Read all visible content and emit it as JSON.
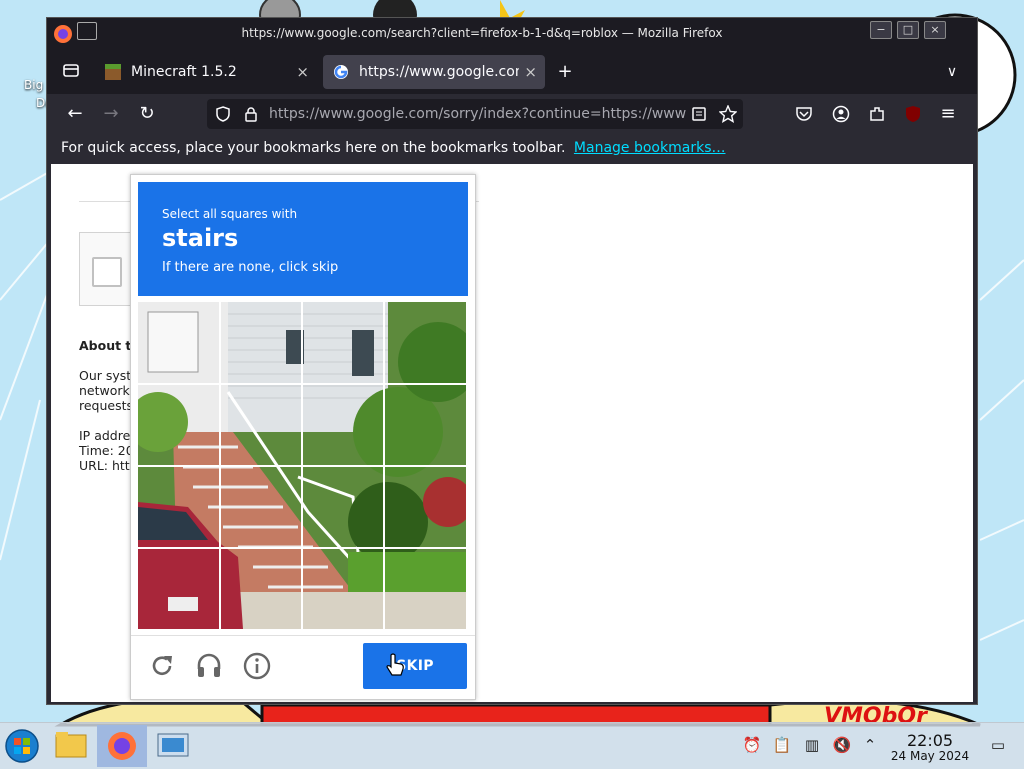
{
  "window": {
    "title": "https://www.google.com/search?client=firefox-b-1-d&q=roblox — Mozilla Firefox",
    "min_label": "−",
    "max_label": "□",
    "close_label": "×"
  },
  "tabs": [
    {
      "label": "Minecraft 1.5.2",
      "icon": "minecraft-icon"
    },
    {
      "label": "https://www.google.com/",
      "icon": "google-icon",
      "active": true
    }
  ],
  "toolbar": {
    "new_tab_label": "+",
    "list_all_tabs_label": "∨",
    "back_label": "←",
    "forward_label": "→",
    "reload_label": "↻",
    "url": "https://www.google.com/sorry/index?continue=https://www",
    "menu_label": "≡"
  },
  "bookmarks_bar": {
    "text": "For quick access, place your bookmarks here on the bookmarks toolbar.",
    "link": "Manage bookmarks…"
  },
  "sorry_page": {
    "about_heading": "About th",
    "para_line1": "Our syste",
    "para_line2": "network,",
    "para_line3": "requests",
    "ip_line": "IP addres",
    "time_line": "Time: 20",
    "url_line": "URL: http"
  },
  "captcha": {
    "instruction": "Select all squares with",
    "target": "stairs",
    "hint": "If there are none, click skip",
    "skip_label": "SKIP",
    "colors": {
      "header": "#1a73e8",
      "button": "#1a73e8"
    }
  },
  "desktop": {
    "icon_label_1": "Big",
    "icon_label_2": "De",
    "wallpaper_text": "VMObOr"
  },
  "taskbar": {
    "time": "22:05",
    "date": "24 May 2024"
  }
}
